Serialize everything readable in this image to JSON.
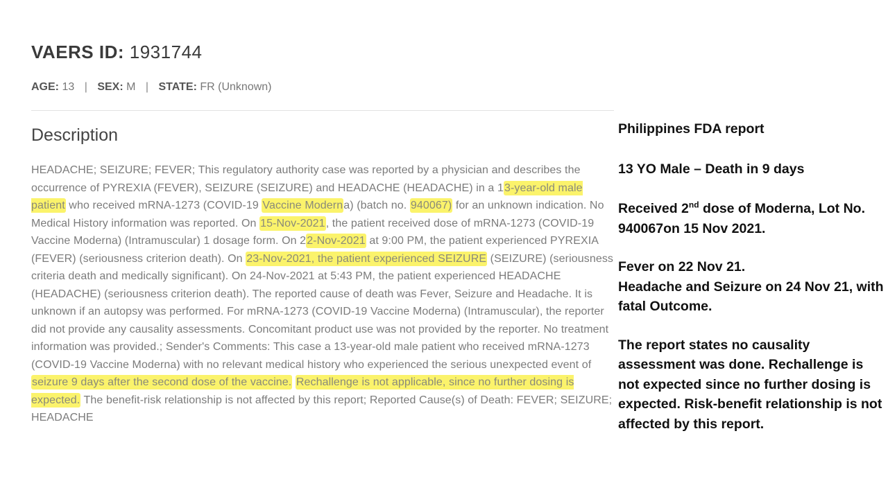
{
  "header": {
    "id_label": "VAERS ID:",
    "id_value": "1931744"
  },
  "meta": {
    "age_label": "AGE:",
    "age_value": "13",
    "sex_label": "SEX:",
    "sex_value": "M",
    "state_label": "STATE:",
    "state_value": "FR (Unknown)",
    "separator": "|"
  },
  "description": {
    "heading": "Description",
    "segments": [
      {
        "text": "HEADACHE; SEIZURE; FEVER; This regulatory authority case was reported by a physician and describes the occurrence of PYREXIA (FEVER), SEIZURE (SEIZURE) and HEADACHE (HEADACHE) in a 1",
        "hl": false
      },
      {
        "text": "3-year-old male patient",
        "hl": true
      },
      {
        "text": " who received mRNA-1273 (COVID-19 ",
        "hl": false
      },
      {
        "text": "Vaccine Modern",
        "hl": true
      },
      {
        "text": "a) (batch no. ",
        "hl": false
      },
      {
        "text": "940067)",
        "hl": true
      },
      {
        "text": " for an unknown indication. No Medical History information was reported. On ",
        "hl": false
      },
      {
        "text": "15-Nov-2021",
        "hl": true
      },
      {
        "text": ", the patient received dose of mRNA-1273 (COVID-19 Vaccine Moderna) (Intramuscular) 1 dosage form. On 2",
        "hl": false
      },
      {
        "text": "2-Nov-2021",
        "hl": true
      },
      {
        "text": " at 9:00 PM, the patient experienced PYREXIA (FEVER) (seriousness criterion death). On ",
        "hl": false
      },
      {
        "text": "23-Nov-2021, the patient experienced SEIZURE",
        "hl": true
      },
      {
        "text": " (SEIZURE) (seriousness criteria death and medically significant). On 24-Nov-2021 at 5:43 PM, the patient experienced HEADACHE (HEADACHE) (seriousness criterion death). The reported cause of death was Fever, Seizure and Headache. It is unknown if an autopsy was performed. For mRNA-1273 (COVID-19 Vaccine Moderna) (Intramuscular), the reporter did not provide any causality assessments. Concomitant product use was not provided by the reporter. No treatment information was provided.; Sender's Comments: This case a 13-year-old male patient who received mRNA-1273 (COVID-19 Vaccine Moderna) with no relevant medical history who experienced the serious unexpected event of ",
        "hl": false
      },
      {
        "text": "seizure 9 days after the second dose of the vaccine.",
        "hl": true
      },
      {
        "text": " ",
        "hl": false
      },
      {
        "text": "Rechallenge is not applicable, since no further dosing is expected.",
        "hl": true
      },
      {
        "text": " The benefit-risk relationship is not affected by this report; Reported Cause(s) of Death: FEVER; SEIZURE; HEADACHE",
        "hl": false
      }
    ]
  },
  "annotation": {
    "title": "Philippines FDA report",
    "summary": "13 YO Male – Death in 9 days",
    "dose_pre": "Received 2",
    "dose_sup": "nd",
    "dose_post": " dose of Moderna, Lot No. 940067on 15 Nov 2021.",
    "fever": "Fever on 22 Nov 21.",
    "headache": "Headache and Seizure on 24 Nov 21, with fatal Outcome.",
    "conclusion": "The report states no causality assessment was done.  Rechallenge is not expected since no further dosing is expected. Risk-benefit relationship is not affected by this report."
  },
  "colors": {
    "highlight": "#fbf36b",
    "body_text": "#7b7b7b"
  }
}
